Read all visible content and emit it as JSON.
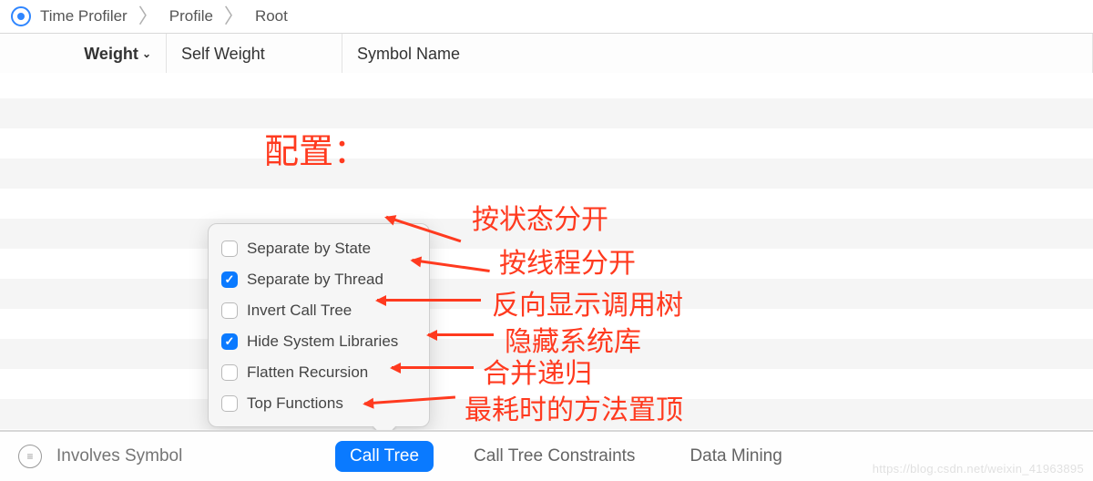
{
  "breadcrumb": {
    "items": [
      "Time Profiler",
      "Profile",
      "Root"
    ]
  },
  "columns": {
    "weight": "Weight",
    "self_weight": "Self Weight",
    "symbol_name": "Symbol Name",
    "sort_indicator": "⌄"
  },
  "popover": {
    "options": [
      {
        "label": "Separate by State",
        "checked": false
      },
      {
        "label": "Separate by Thread",
        "checked": true
      },
      {
        "label": "Invert Call Tree",
        "checked": false
      },
      {
        "label": "Hide System Libraries",
        "checked": true
      },
      {
        "label": "Flatten Recursion",
        "checked": false
      },
      {
        "label": "Top Functions",
        "checked": false
      }
    ]
  },
  "toolbar": {
    "search_placeholder": "Involves Symbol",
    "buttons": {
      "call_tree": "Call Tree",
      "constraints": "Call Tree Constraints",
      "data_mining": "Data Mining"
    }
  },
  "annotations": {
    "title": "配置：",
    "by_state": "按状态分开",
    "by_thread": "按线程分开",
    "invert": "反向显示调用树",
    "hide_sys": "隐藏系统库",
    "flatten": "合并递归",
    "top_fn": "最耗时的方法置顶"
  },
  "watermark": "https://blog.csdn.net/weixin_41963895"
}
